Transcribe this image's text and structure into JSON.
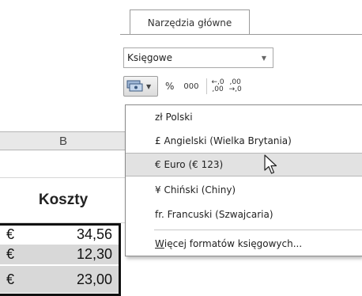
{
  "ribbon": {
    "tab_label": "Narzędzia główne",
    "number_format": {
      "value": "Księgowe"
    },
    "buttons": {
      "percent": "%",
      "thousands": "000",
      "increase_decimal_top": "←,0",
      "increase_decimal_bottom": ",00",
      "decrease_decimal_top": ",00",
      "decrease_decimal_bottom": "→,0"
    }
  },
  "sheet": {
    "column_header": "B",
    "header_cell": "Koszty",
    "rows": [
      {
        "symbol": "€",
        "value": "34,56"
      },
      {
        "symbol": "€",
        "value": "12,30"
      },
      {
        "symbol": "€",
        "value": "23,00"
      }
    ]
  },
  "menu": {
    "items": [
      "zł Polski",
      "£ Angielski (Wielka  Brytania)",
      "€ Euro (€ 123)",
      "¥ Chiński (Chiny)",
      "fr. Francuski (Szwajcaria)"
    ],
    "highlighted_index": 2,
    "more_first": "W",
    "more_rest": "ięcej formatów księgowych..."
  },
  "colors": {
    "highlight": "#e2e2e2",
    "selected_cell_bg": "#d8d8d8"
  }
}
